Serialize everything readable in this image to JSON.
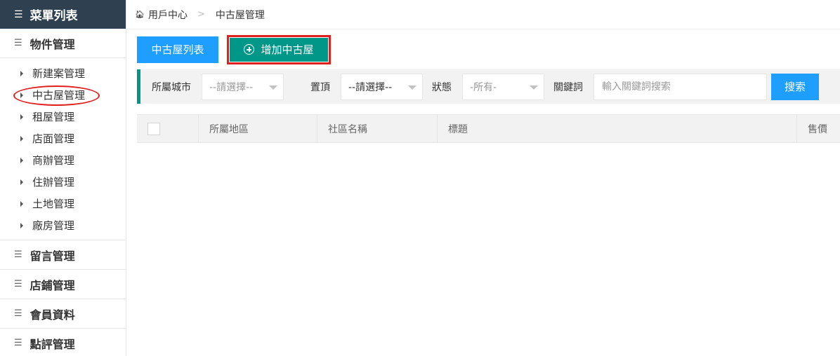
{
  "sidebar": {
    "header": "菜單列表",
    "groups": [
      {
        "label": "物件管理"
      },
      {
        "label": "留言管理"
      },
      {
        "label": "店鋪管理"
      },
      {
        "label": "會員資料"
      },
      {
        "label": "點評管理"
      }
    ],
    "subitems": [
      {
        "label": "新建案管理"
      },
      {
        "label": "中古屋管理",
        "active": true
      },
      {
        "label": "租屋管理"
      },
      {
        "label": "店面管理"
      },
      {
        "label": "商辦管理"
      },
      {
        "label": "住辦管理"
      },
      {
        "label": "土地管理"
      },
      {
        "label": "廠房管理"
      }
    ]
  },
  "breadcrumb": {
    "home": "用戶中心",
    "current": "中古屋管理"
  },
  "buttons": {
    "list": "中古屋列表",
    "add": "增加中古屋"
  },
  "filters": {
    "city_label": "所屬城市",
    "city_value": "--請選擇--",
    "top_label": "置頂",
    "top_value": "--請選擇--",
    "status_label": "狀態",
    "status_value": "-所有-",
    "keyword_label": "關鍵詞",
    "keyword_placeholder": "輸入關鍵詞搜索",
    "search_button": "搜索"
  },
  "table": {
    "columns": [
      "所屬地區",
      "社區名稱",
      "標題",
      "售價"
    ]
  },
  "colors": {
    "sidebar_header": "#2f4050",
    "primary_blue": "#1e9fff",
    "primary_green": "#009688",
    "annotation_red": "#e02020"
  }
}
